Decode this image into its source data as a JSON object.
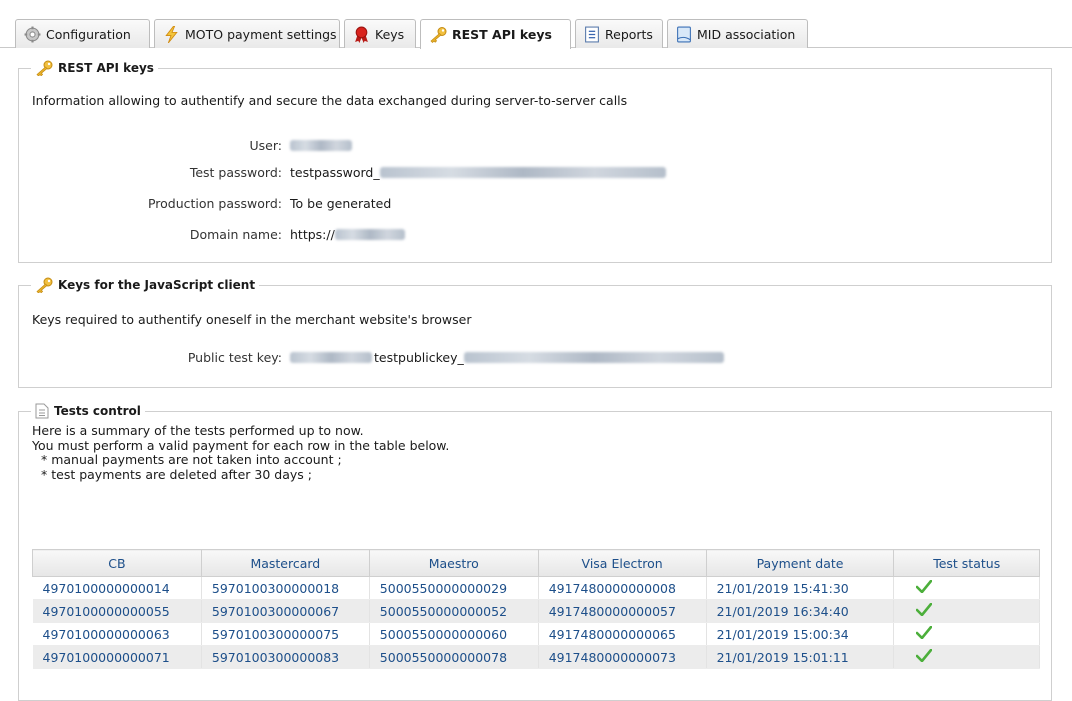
{
  "tabs": [
    {
      "label": "Configuration",
      "icon": "gear-icon",
      "active": false
    },
    {
      "label": "MOTO payment settings",
      "icon": "lightning-icon",
      "active": false
    },
    {
      "label": "Keys",
      "icon": "key-badge-icon",
      "active": false
    },
    {
      "label": "REST API keys",
      "icon": "key-icon",
      "active": true
    },
    {
      "label": "Reports",
      "icon": "report-icon",
      "active": false
    },
    {
      "label": "MID association",
      "icon": "document-icon",
      "active": false
    }
  ],
  "rest_api": {
    "legend": "REST API keys",
    "description": "Information allowing to authentify and secure the data exchanged during server-to-server calls",
    "user_label": "User:",
    "test_password_label": "Test password:",
    "test_password_value": "testpassword_",
    "production_password_label": "Production password:",
    "production_password_value": "To be generated",
    "domain_label": "Domain name:",
    "domain_value": "https://"
  },
  "js_client": {
    "legend": "Keys for the JavaScript client",
    "description": "Keys required to authentify oneself in the merchant website's browser",
    "public_key_label": "Public test key:",
    "public_key_value": "testpublickey_"
  },
  "tests": {
    "legend": "Tests control",
    "intro_line1": "Here is a summary of the tests performed up to now.",
    "intro_line2": "You must perform a valid payment for each row in the table below.",
    "bullet1": "* manual payments are not taken into account ;",
    "bullet2": "* test payments are deleted after 30 days ;",
    "columns": [
      "CB",
      "Mastercard",
      "Maestro",
      "Visa Electron",
      "Payment date",
      "Test status"
    ],
    "rows": [
      [
        "4970100000000014",
        "5970100300000018",
        "5000550000000029",
        "4917480000000008",
        "21/01/2019 15:41:30"
      ],
      [
        "4970100000000055",
        "5970100300000067",
        "5000550000000052",
        "4917480000000057",
        "21/01/2019 16:34:40"
      ],
      [
        "4970100000000063",
        "5970100300000075",
        "5000550000000060",
        "4917480000000065",
        "21/01/2019 15:00:34"
      ],
      [
        "4970100000000071",
        "5970100300000083",
        "5000550000000078",
        "4917480000000073",
        "21/01/2019 15:01:11"
      ]
    ],
    "status_icon": "checkmark-icon",
    "status_color": "#4caf3b"
  },
  "colors": {
    "link_blue": "#1d4f8a",
    "key_gold": "#e8b22a",
    "badge_red": "#d9231d"
  }
}
